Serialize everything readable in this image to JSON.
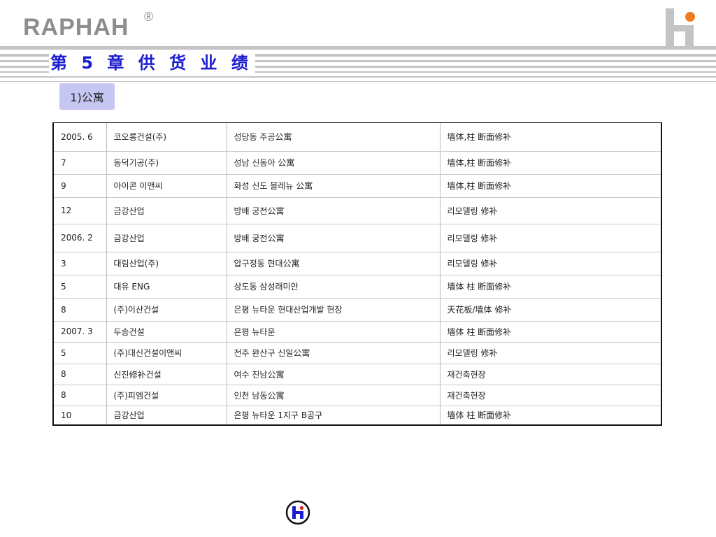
{
  "header": {
    "brand": "RAPHAH",
    "registered_mark": "®",
    "chapter_title": "第 5 章  供 货 业 绩"
  },
  "section": {
    "label": "1)公寓"
  },
  "table": {
    "rows": [
      [
        "2005. 6",
        "코오롱건설(주)",
        "성당동 주공公寓",
        "墙体,柱 断面修补"
      ],
      [
        "7",
        "동덕기공(주)",
        "성남 신동아 公寓",
        "墙体,柱 断面修补"
      ],
      [
        "9",
        "아이콘 이앤씨",
        "화성 신도 블레뉴 公寓",
        "墙体,柱 断面修补"
      ],
      [
        "12",
        "금강산업",
        "방배 궁전公寓",
        "리모델링 修补"
      ],
      [
        "2006. 2",
        "금강산업",
        "방배 궁전公寓",
        "리모델링 修补"
      ],
      [
        "3",
        "대림산업(주)",
        "압구정동 현대公寓",
        "리모델링 修补"
      ],
      [
        "5",
        "대유 ENG",
        "상도동 삼성래미안",
        "墙体 柱 断面修补"
      ],
      [
        "8",
        "(주)이산건설",
        "은평 뉴타운 현대산업개발 현장",
        "天花板/墙体 修补"
      ],
      [
        "2007. 3",
        "두송건설",
        "은평 뉴타운",
        "墙体 柱 断面修补"
      ],
      [
        "5",
        "(주)대신건설이앤씨",
        "전주 완산구 신일公寓",
        "리모델링 修补"
      ],
      [
        "8",
        "신진修补건설",
        "여수 진남公寓",
        "재건축현장"
      ],
      [
        "8",
        "(주)피엠건설",
        "인천 남동公寓",
        "재건축현장"
      ],
      [
        "10",
        "금강산업",
        "은평 뉴타운 1지구 B공구",
        "墙体 柱 断面修补"
      ]
    ]
  },
  "colors": {
    "title_blue": "#1c1cd0",
    "badge_bg": "#c6c6f2",
    "brand_gray": "#8e8e8e",
    "logo_orange": "#f07a1e",
    "logo_blue": "#1c1cd0",
    "logo_red": "#e02020"
  },
  "icons": {
    "top_right": "company-logo-icon",
    "bottom_center": "company-emblem-icon"
  }
}
